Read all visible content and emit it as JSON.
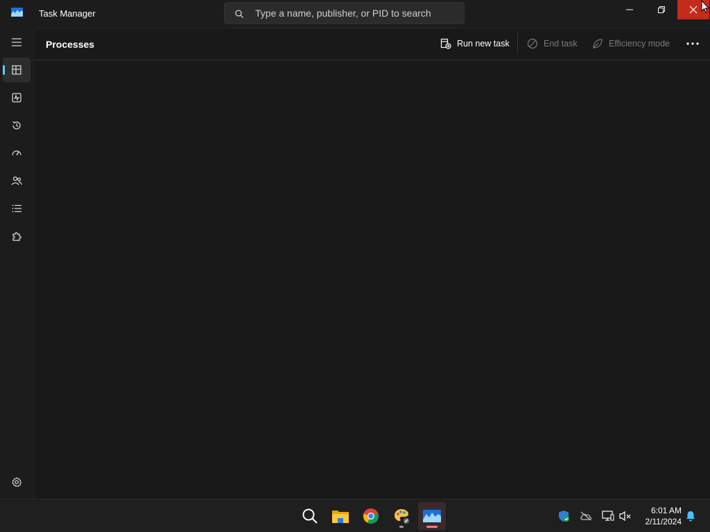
{
  "window": {
    "title": "Task Manager",
    "search_placeholder": "Type a name, publisher, or PID to search",
    "accent_color": "#60cdff",
    "close_hover_color": "#c42b1c"
  },
  "nav": {
    "items": [
      {
        "name": "menu",
        "icon": "hamburger-icon"
      },
      {
        "name": "processes",
        "icon": "processes-icon",
        "active": true
      },
      {
        "name": "performance",
        "icon": "performance-icon"
      },
      {
        "name": "app-history",
        "icon": "history-icon"
      },
      {
        "name": "startup-apps",
        "icon": "speedometer-icon"
      },
      {
        "name": "users",
        "icon": "users-icon"
      },
      {
        "name": "details",
        "icon": "list-icon"
      },
      {
        "name": "services",
        "icon": "puzzle-icon"
      }
    ],
    "settings_icon": "gear-icon"
  },
  "page": {
    "title": "Processes",
    "run_new_task": "Run new task",
    "end_task": "End task",
    "efficiency_mode": "Efficiency mode"
  },
  "taskbar": {
    "apps": [
      {
        "name": "search",
        "icon": "search-icon"
      },
      {
        "name": "file-explorer",
        "icon": "folder-icon"
      },
      {
        "name": "chrome",
        "icon": "chrome-icon"
      },
      {
        "name": "paint-app",
        "icon": "palette-icon"
      },
      {
        "name": "task-manager",
        "icon": "task-manager-icon",
        "active": true
      }
    ],
    "tray": [
      "shield-icon",
      "cloud-off-icon",
      "network-icon",
      "volume-mute-icon"
    ],
    "time": "6:01 AM",
    "date": "2/11/2024"
  }
}
